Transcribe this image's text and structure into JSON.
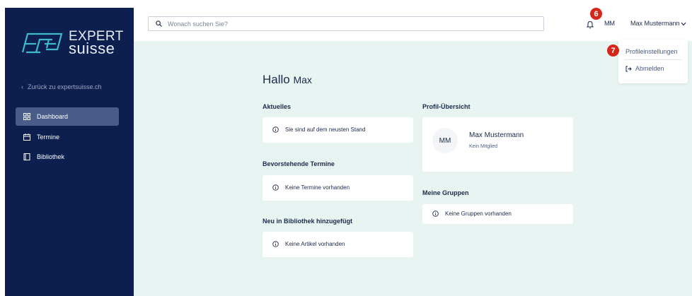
{
  "sidebar": {
    "logo": {
      "line1": "EXPERT",
      "line2": "suisse"
    },
    "back_label": "Zurück zu expertsuisse.ch",
    "items": [
      {
        "label": "Dashboard",
        "icon": "dashboard-icon",
        "active": true
      },
      {
        "label": "Termine",
        "icon": "calendar-icon",
        "active": false
      },
      {
        "label": "Bibliothek",
        "icon": "book-icon",
        "active": false
      }
    ]
  },
  "header": {
    "search_placeholder": "Wonach suchen Sie?",
    "avatar_initials": "MM",
    "user_name": "Max Mustermann",
    "annotation_bell": "6"
  },
  "dropdown": {
    "profile_label": "Profileinstellungen",
    "logout_label": "Abmelden",
    "annotation": "7"
  },
  "main": {
    "greeting": "Hallo",
    "greeting_name": "Max",
    "sections": {
      "aktuelles": {
        "title": "Aktuelles",
        "message": "Sie sind auf dem neusten Stand"
      },
      "termine": {
        "title": "Bevorstehende Termine",
        "message": "Keine Termine vorhanden"
      },
      "bibliothek": {
        "title": "Neu in Bibliothek hinzugefügt",
        "message": "Keine Artikel vorhanden"
      },
      "profil": {
        "title": "Profil-Übersicht",
        "initials": "MM",
        "name": "Max Mustermann",
        "status": "Kein Mitglied"
      },
      "gruppen": {
        "title": "Meine Gruppen",
        "message": "Keine Gruppen vorhanden"
      }
    }
  },
  "colors": {
    "sidebar_bg": "#0d1f4f",
    "active_item": "#4a5d8a",
    "main_bg": "#e7f4f2",
    "badge": "#d5261a"
  }
}
